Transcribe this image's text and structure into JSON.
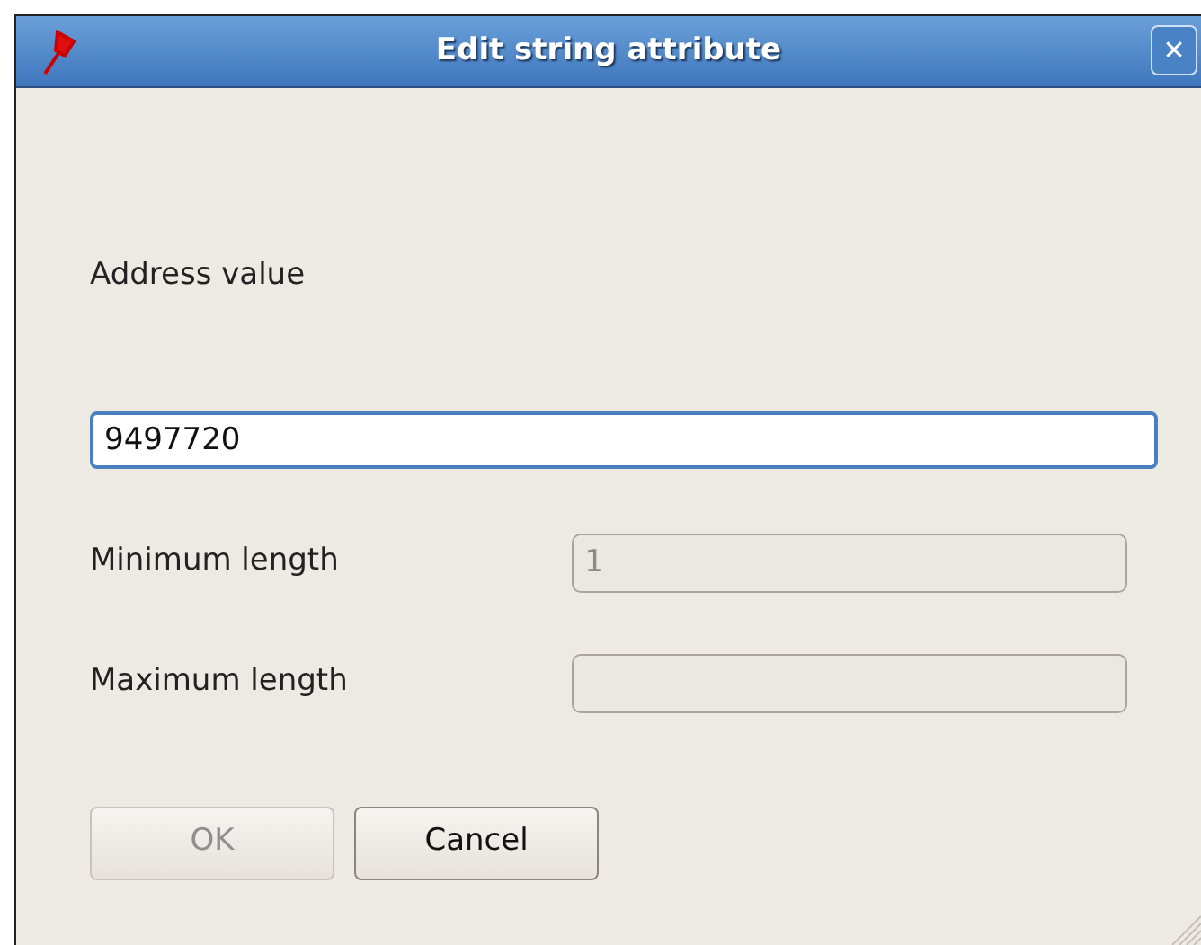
{
  "window": {
    "title": "Edit string attribute",
    "close": "✕"
  },
  "address": {
    "label": "Address value",
    "value": "9497720",
    "focused": true
  },
  "fields": [
    {
      "label": "Minimum length",
      "value": "1",
      "disabled": true
    },
    {
      "label": "Maximum length",
      "disabled": true
    }
  ],
  "buttons": [
    {
      "label": "OK",
      "disabled": true
    },
    {
      "label": "Cancel",
      "disabled": false
    }
  ]
}
